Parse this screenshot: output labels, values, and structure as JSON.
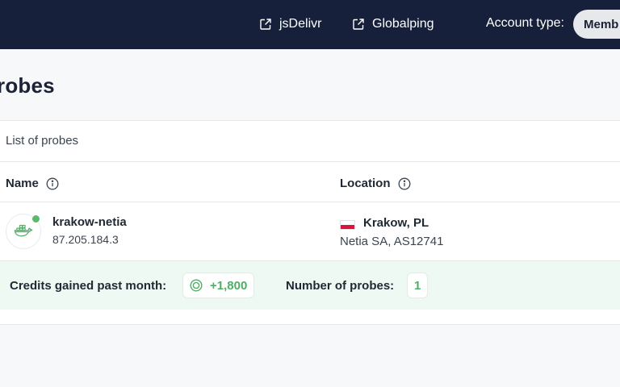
{
  "header": {
    "links": [
      {
        "label": "jsDelivr",
        "icon": "external-link-icon"
      },
      {
        "label": "Globalping",
        "icon": "external-link-icon"
      }
    ],
    "account_label": "Account type:",
    "account_value": "Memb"
  },
  "page": {
    "title": "robes"
  },
  "card": {
    "title": "List of probes",
    "columns": [
      {
        "label": "Name",
        "icon": "info-icon"
      },
      {
        "label": "Location",
        "icon": "info-icon"
      }
    ],
    "rows": [
      {
        "name": "krakow-netia",
        "ip": "87.205.184.3",
        "status": "online",
        "status_color": "#5cb86b",
        "avatar_icon": "docker-icon",
        "city": "Krakow, PL",
        "network": "Netia SA, AS12741",
        "flag": "poland-flag-icon"
      }
    ],
    "summary": {
      "credits_label": "Credits gained past month:",
      "credits_value": "+1,800",
      "probes_label": "Number of probes:",
      "probes_value": "1"
    }
  },
  "colors": {
    "topbar": "#17203a",
    "accent_green": "#4caf64",
    "summary_bg": "#eef9f3"
  }
}
